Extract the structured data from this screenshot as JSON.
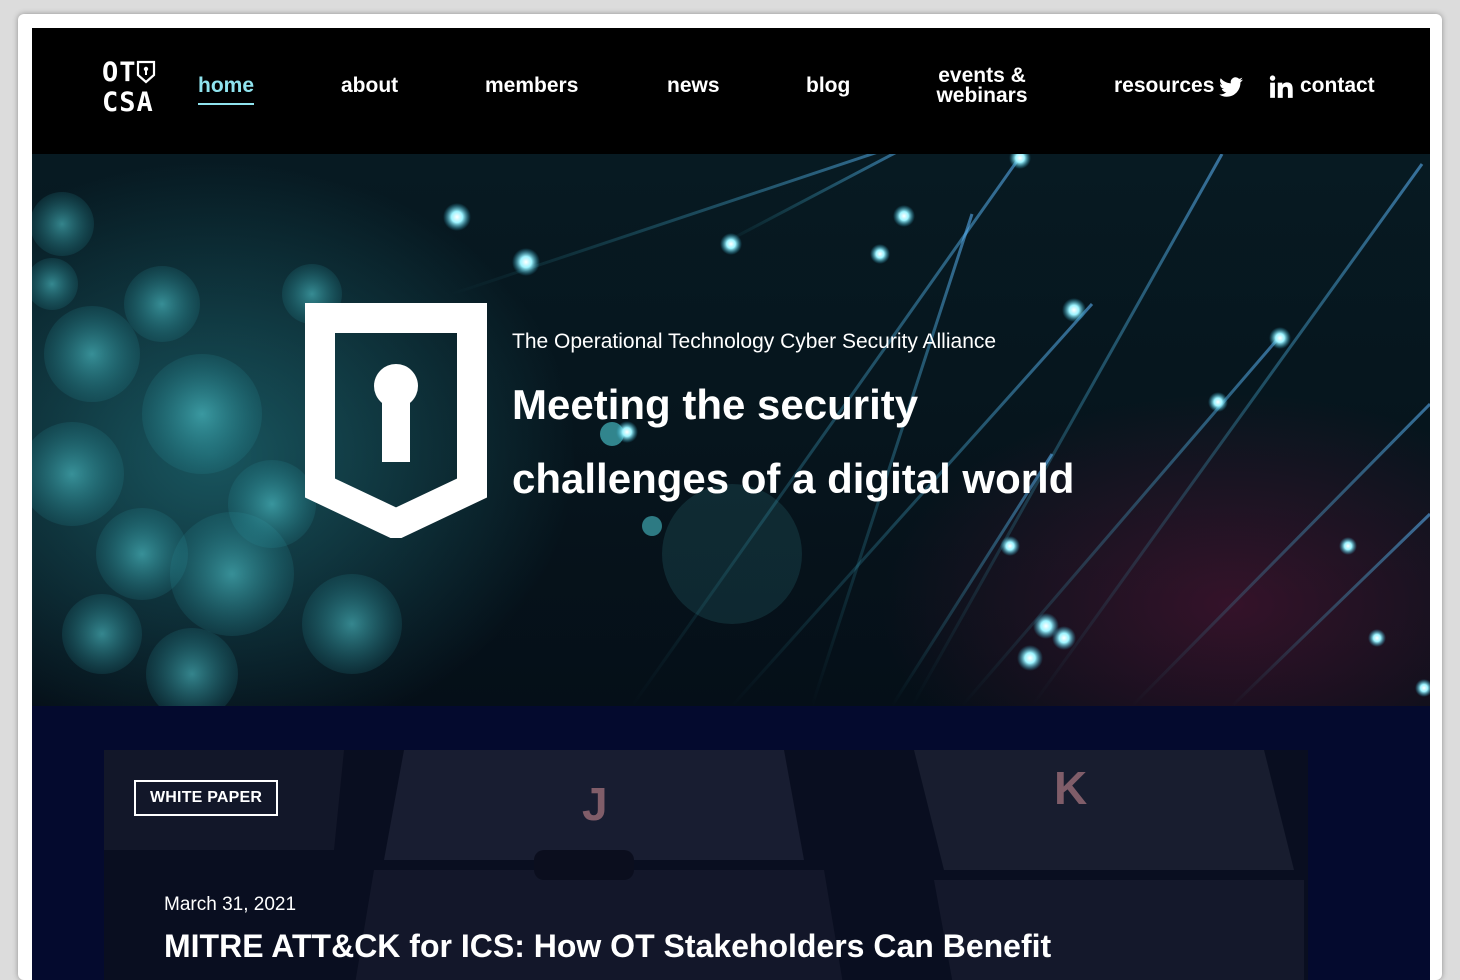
{
  "header": {
    "logo_line1": "OT",
    "logo_line2": "CSA",
    "nav": {
      "home": "home",
      "about": "about",
      "members": "members",
      "news": "news",
      "blog": "blog",
      "events_line1": "events &",
      "events_line2": "webinars",
      "resources": "resources",
      "contact": "contact"
    },
    "social": [
      "twitter-icon",
      "linkedin-icon"
    ],
    "active_color": "#8fe3ee"
  },
  "hero": {
    "eyebrow": "The Operational Technology Cyber Security Alliance",
    "title_line1": "Meeting the security",
    "title_line2": "challenges of a digital world",
    "icon": "shield-keyhole-icon"
  },
  "feature": {
    "badge": "WHITE PAPER",
    "date": "March 31, 2021",
    "title": "MITRE ATT&CK for ICS: How OT Stakeholders Can Benefit",
    "background_color": "#040a2e"
  }
}
